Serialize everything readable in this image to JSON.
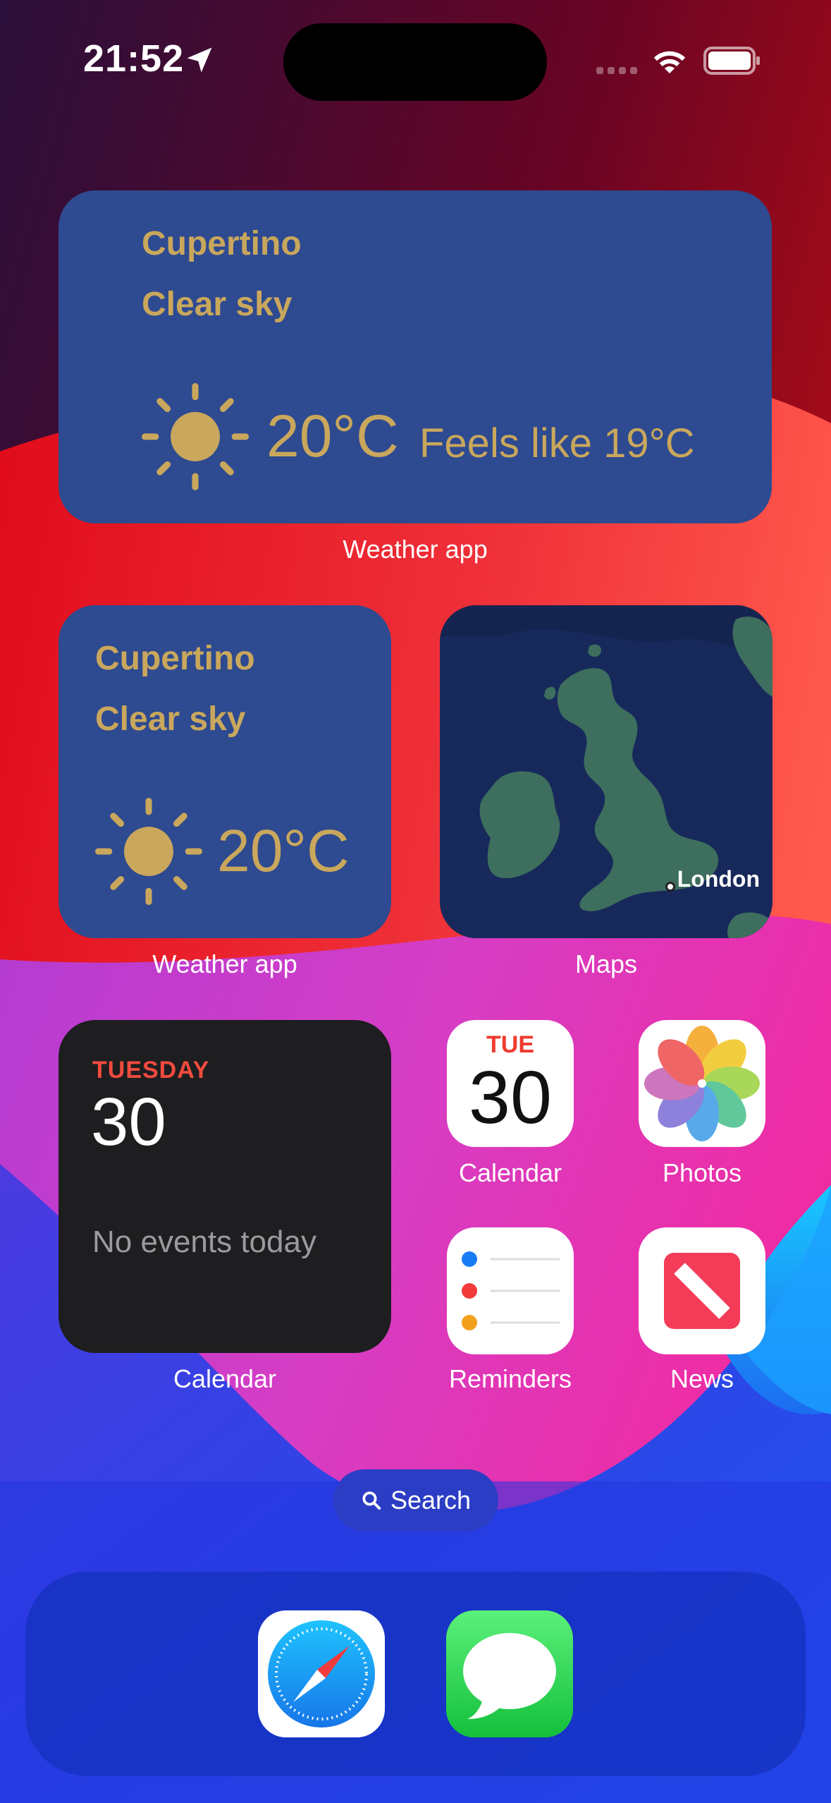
{
  "status_bar": {
    "time": "21:52"
  },
  "weather_large": {
    "city": "Cupertino",
    "condition": "Clear sky",
    "temperature": "20°C",
    "feels_like": "Feels like 19°C",
    "label": "Weather app"
  },
  "weather_small": {
    "city": "Cupertino",
    "condition": "Clear sky",
    "temperature": "20°C",
    "label": "Weather app"
  },
  "maps_widget": {
    "place": "London",
    "label": "Maps"
  },
  "calendar_widget": {
    "weekday": "TUESDAY",
    "date": "30",
    "empty_text": "No events today",
    "label": "Calendar"
  },
  "apps": {
    "calendar": {
      "weekday": "TUE",
      "date": "30",
      "label": "Calendar"
    },
    "photos": {
      "label": "Photos"
    },
    "reminders": {
      "label": "Reminders"
    },
    "news": {
      "label": "News"
    }
  },
  "search": {
    "label": "Search"
  },
  "dock": {
    "apps": [
      "safari-icon",
      "messages-icon"
    ]
  },
  "colors": {
    "weather_bg": "#2e4a90",
    "weather_text": "#c9a75c",
    "calendar_red": "#ef3b2e"
  }
}
